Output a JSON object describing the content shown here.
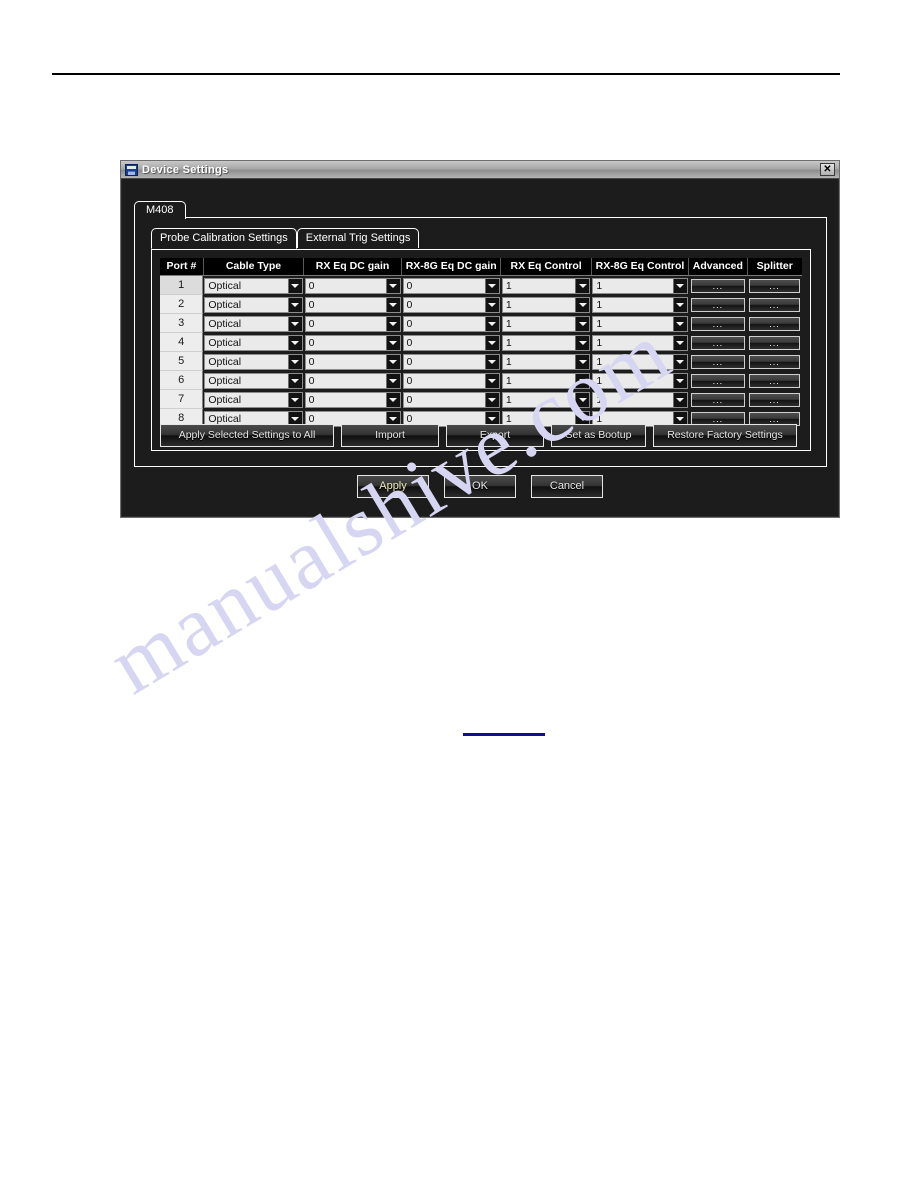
{
  "page": {
    "watermark": "manualshive.com"
  },
  "dialog": {
    "title": "Device Settings",
    "close_label": "✕",
    "icon": "device-settings-icon"
  },
  "outer_tabs": [
    {
      "label": "M408",
      "active": true
    }
  ],
  "inner_tabs": [
    {
      "label": "Probe Calibration Settings",
      "active": true
    },
    {
      "label": "External Trig Settings",
      "active": false
    }
  ],
  "table": {
    "columns": [
      "Port #",
      "Cable Type",
      "RX Eq DC gain",
      "RX-8G Eq DC gain",
      "RX Eq Control",
      "RX-8G Eq Control",
      "Advanced",
      "Splitter"
    ],
    "dots_label": "...",
    "rows": [
      {
        "port": "1",
        "cable_type": "Optical",
        "rx_eq_dc_gain": "0",
        "rx8g_eq_dc_gain": "0",
        "rx_eq_control": "1",
        "rx8g_eq_control": "1",
        "advanced": "...",
        "splitter": "...",
        "selected": true
      },
      {
        "port": "2",
        "cable_type": "Optical",
        "rx_eq_dc_gain": "0",
        "rx8g_eq_dc_gain": "0",
        "rx_eq_control": "1",
        "rx8g_eq_control": "1",
        "advanced": "...",
        "splitter": "...",
        "selected": false
      },
      {
        "port": "3",
        "cable_type": "Optical",
        "rx_eq_dc_gain": "0",
        "rx8g_eq_dc_gain": "0",
        "rx_eq_control": "1",
        "rx8g_eq_control": "1",
        "advanced": "...",
        "splitter": "...",
        "selected": false
      },
      {
        "port": "4",
        "cable_type": "Optical",
        "rx_eq_dc_gain": "0",
        "rx8g_eq_dc_gain": "0",
        "rx_eq_control": "1",
        "rx8g_eq_control": "1",
        "advanced": "...",
        "splitter": "...",
        "selected": false
      },
      {
        "port": "5",
        "cable_type": "Optical",
        "rx_eq_dc_gain": "0",
        "rx8g_eq_dc_gain": "0",
        "rx_eq_control": "1",
        "rx8g_eq_control": "1",
        "advanced": "...",
        "splitter": "...",
        "selected": false
      },
      {
        "port": "6",
        "cable_type": "Optical",
        "rx_eq_dc_gain": "0",
        "rx8g_eq_dc_gain": "0",
        "rx_eq_control": "1",
        "rx8g_eq_control": "1",
        "advanced": "...",
        "splitter": "...",
        "selected": false
      },
      {
        "port": "7",
        "cable_type": "Optical",
        "rx_eq_dc_gain": "0",
        "rx8g_eq_dc_gain": "0",
        "rx_eq_control": "1",
        "rx8g_eq_control": "1",
        "advanced": "...",
        "splitter": "...",
        "selected": false
      },
      {
        "port": "8",
        "cable_type": "Optical",
        "rx_eq_dc_gain": "0",
        "rx8g_eq_dc_gain": "0",
        "rx_eq_control": "1",
        "rx8g_eq_control": "1",
        "advanced": "...",
        "splitter": "...",
        "selected": false
      }
    ]
  },
  "actions": {
    "apply_all": "Apply Selected Settings to All",
    "import": "Import",
    "export": "Export",
    "set_bootup": "Set as Bootup",
    "restore": "Restore Factory Settings"
  },
  "footer": {
    "apply": "Apply",
    "ok": "OK",
    "cancel": "Cancel"
  },
  "colors": {
    "dialog_bg": "#1c1c1c",
    "header_bg": "#000000",
    "field_bg": "#eaeaea",
    "link_blue": "#10108c",
    "watermark": "#d6d6f2"
  }
}
